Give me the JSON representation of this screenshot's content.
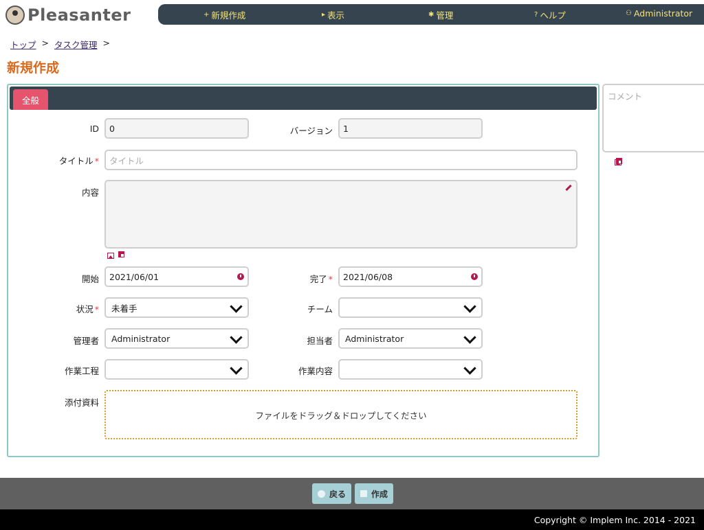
{
  "app": {
    "name": "Pleasanter"
  },
  "nav": {
    "new": {
      "icon": "plus-icon",
      "glyph": "+",
      "label": "新規作成"
    },
    "view": {
      "icon": "triangle-right-icon",
      "glyph": "▸",
      "label": "表示"
    },
    "manage": {
      "icon": "gear-icon",
      "glyph": "✱",
      "label": "管理"
    },
    "help": {
      "icon": "question-icon",
      "glyph": "?",
      "label": "ヘルプ"
    },
    "user": {
      "icon": "person-icon",
      "glyph": "⚇",
      "label": "Administrator"
    }
  },
  "breadcrumb": {
    "top": "トップ",
    "sep": ">",
    "tasks": "タスク管理"
  },
  "page": {
    "title": "新規作成"
  },
  "tabs": {
    "general": "全般"
  },
  "form": {
    "id": {
      "label": "ID",
      "value": "0"
    },
    "version": {
      "label": "バージョン",
      "value": "1"
    },
    "title": {
      "label": "タイトル",
      "required": "*",
      "placeholder": "タイトル"
    },
    "body": {
      "label": "内容"
    },
    "start": {
      "label": "開始",
      "value": "2021/06/01"
    },
    "complete": {
      "label": "完了",
      "required": "*",
      "value": "2021/06/08"
    },
    "status": {
      "label": "状況",
      "required": "*",
      "value": "未着手"
    },
    "team": {
      "label": "チーム",
      "value": ""
    },
    "manager": {
      "label": "管理者",
      "value": "Administrator"
    },
    "owner": {
      "label": "担当者",
      "value": "Administrator"
    },
    "process": {
      "label": "作業工程",
      "value": ""
    },
    "work": {
      "label": "作業内容",
      "value": ""
    },
    "attachments": {
      "label": "添付資料",
      "dropzone": "ファイルをドラッグ＆ドロップしてください"
    }
  },
  "comment": {
    "placeholder": "コメント"
  },
  "actions": {
    "back": "戻る",
    "create": "作成"
  },
  "footer": {
    "copyright": "Copyright © Implem Inc. 2014 - 2021"
  },
  "colors": {
    "accent": "#d76a1f",
    "nav_bg": "#36444f",
    "nav_text": "#f3e27a",
    "tab": "#e5546c",
    "icon": "#b5194b"
  }
}
